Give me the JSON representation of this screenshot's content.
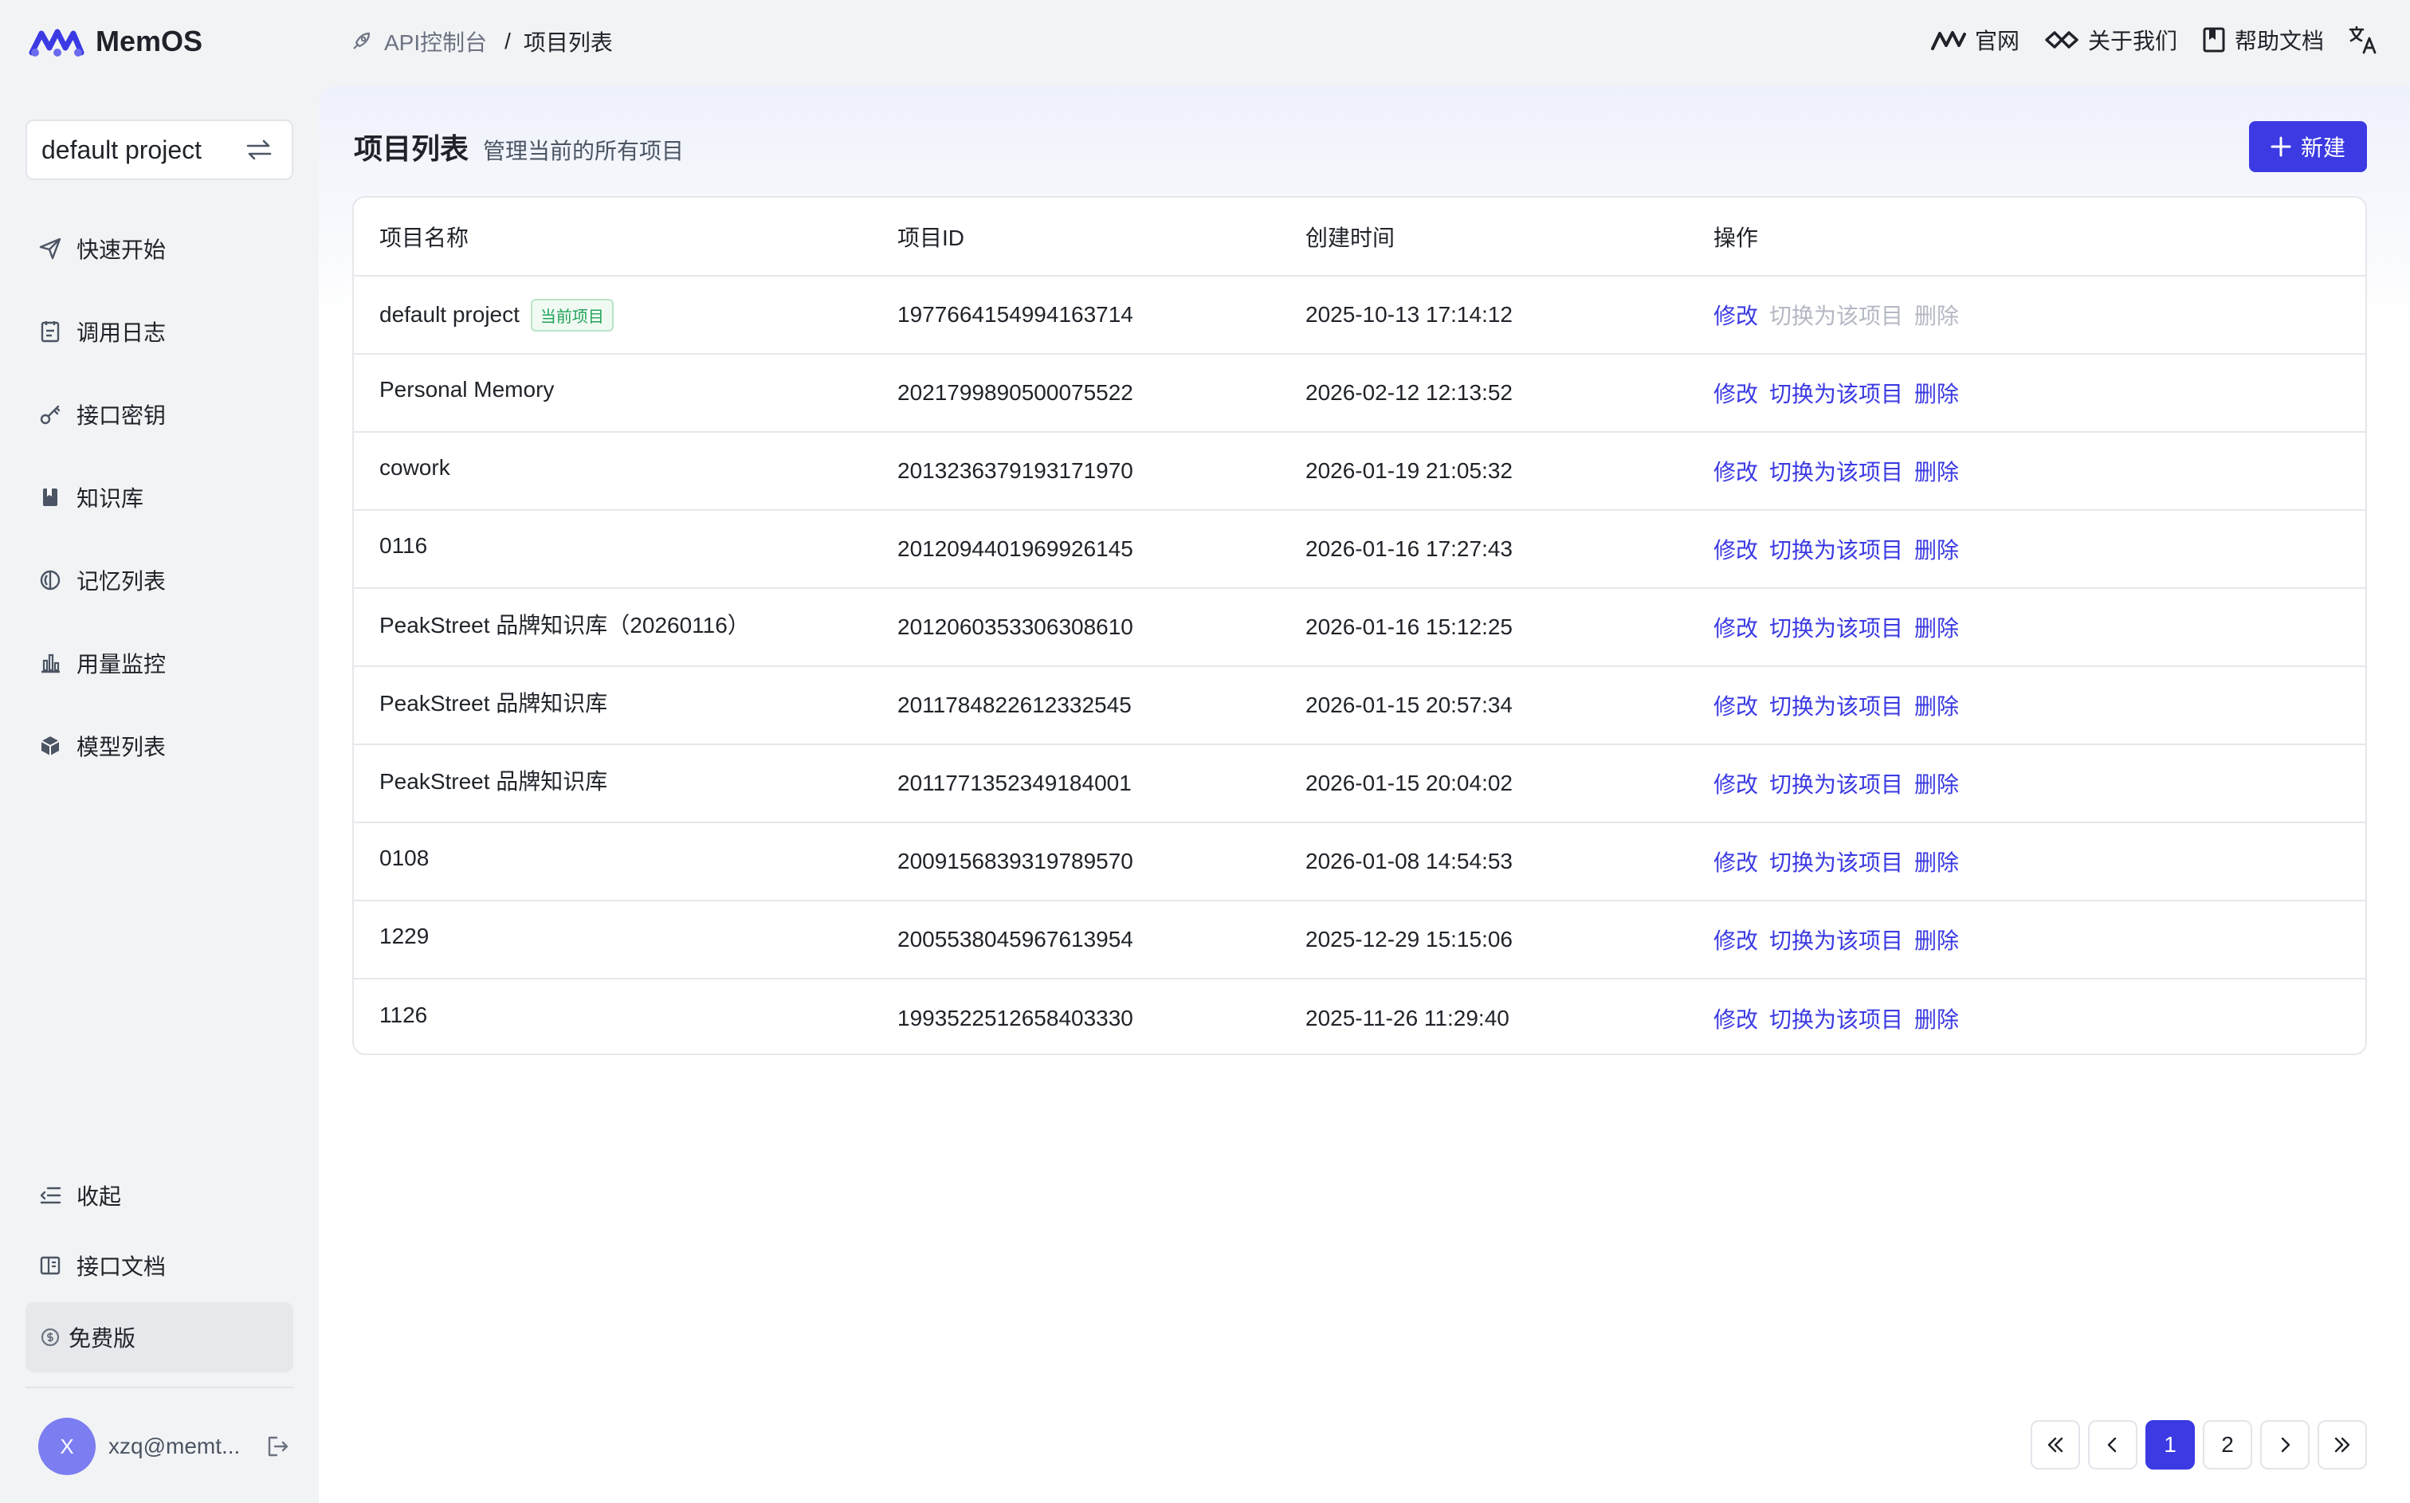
{
  "app": {
    "name": "MemOS"
  },
  "breadcrumb": {
    "root": "API控制台",
    "current": "项目列表"
  },
  "toplinks": {
    "site": "官网",
    "about": "关于我们",
    "docs": "帮助文档"
  },
  "sidebar": {
    "project": "default project",
    "items": [
      {
        "label": "快速开始",
        "icon": "send-icon"
      },
      {
        "label": "调用日志",
        "icon": "log-icon"
      },
      {
        "label": "接口密钥",
        "icon": "key-icon"
      },
      {
        "label": "知识库",
        "icon": "book-icon"
      },
      {
        "label": "记忆列表",
        "icon": "memory-icon"
      },
      {
        "label": "用量监控",
        "icon": "bar-chart-icon"
      },
      {
        "label": "模型列表",
        "icon": "cube-icon"
      }
    ],
    "collapse": "收起",
    "api_docs": "接口文档",
    "plan": "免费版",
    "user": {
      "avatar": "X",
      "email": "xzq@memt..."
    }
  },
  "page": {
    "title": "项目列表",
    "subtitle": "管理当前的所有项目",
    "new_button": "新建"
  },
  "table": {
    "headers": [
      "项目名称",
      "项目ID",
      "创建时间",
      "操作"
    ],
    "current_badge": "当前项目",
    "actions": {
      "edit": "修改",
      "switch": "切换为该项目",
      "delete": "删除"
    },
    "rows": [
      {
        "name": "default project",
        "id": "1977664154994163714",
        "created": "2025-10-13 17:14:12"
      },
      {
        "name": "Personal Memory",
        "id": "2021799890500075522",
        "created": "2026-02-12 12:13:52"
      },
      {
        "name": "cowork",
        "id": "2013236379193171970",
        "created": "2026-01-19 21:05:32"
      },
      {
        "name": "0116",
        "id": "2012094401969926145",
        "created": "2026-01-16 17:27:43"
      },
      {
        "name": "PeakStreet 品牌知识库（20260116）",
        "id": "2012060353306308610",
        "created": "2026-01-16 15:12:25"
      },
      {
        "name": "PeakStreet 品牌知识库",
        "id": "2011784822612332545",
        "created": "2026-01-15 20:57:34"
      },
      {
        "name": "PeakStreet 品牌知识库",
        "id": "2011771352349184001",
        "created": "2026-01-15 20:04:02"
      },
      {
        "name": "0108",
        "id": "2009156839319789570",
        "created": "2026-01-08 14:54:53"
      },
      {
        "name": "1229",
        "id": "2005538045967613954",
        "created": "2025-12-29 15:15:06"
      },
      {
        "name": "1126",
        "id": "1993522512658403330",
        "created": "2025-11-26 11:29:40"
      }
    ]
  },
  "pagination": {
    "pages": [
      "1",
      "2"
    ],
    "current": "1"
  },
  "colors": {
    "accent": "#3b3ae3",
    "badge_green": "#22a35a",
    "disabled": "#b4b8c4"
  }
}
